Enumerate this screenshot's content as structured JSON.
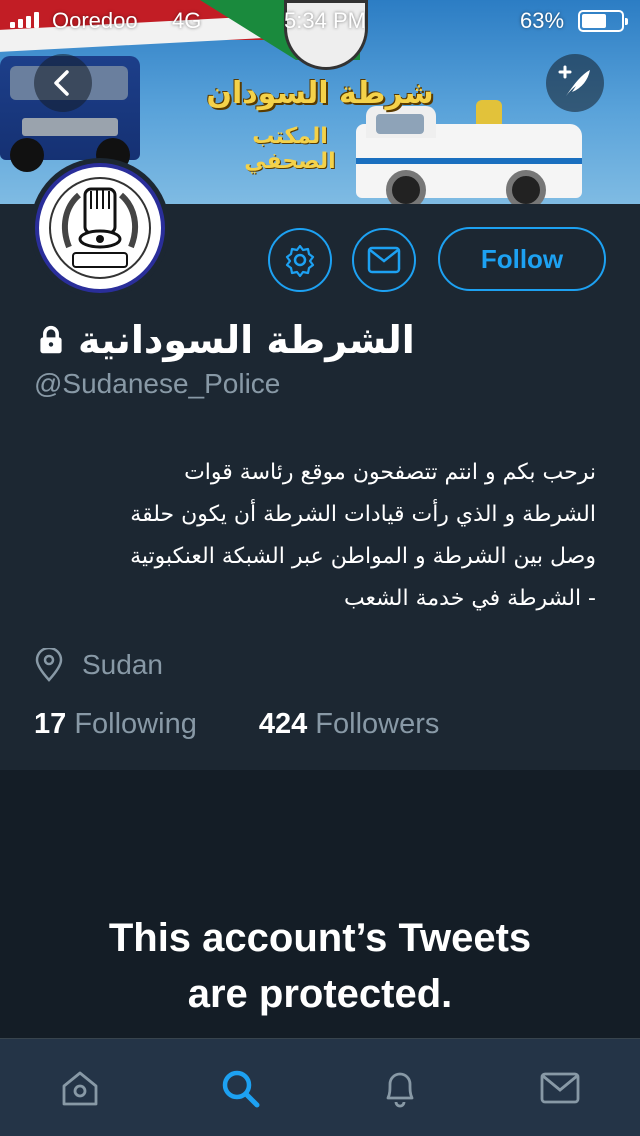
{
  "status_bar": {
    "carrier": "Ooredoo",
    "network": "4G",
    "time": "5:34 PM",
    "battery_percent": "63%",
    "battery_level": 0.63,
    "signal_bars": 4
  },
  "banner": {
    "title": "شرطة السودان",
    "subtitle": "المكتب الصحفي"
  },
  "header": {
    "back_icon": "chevron-left-icon",
    "compose_icon": "compose-tweet-icon"
  },
  "profile": {
    "display_name": "الشرطة السودانية",
    "handle": "@Sudanese_Police",
    "protected": true,
    "bio_lines": [
      "نرحب بكم و انتم تتصفحون موقع رئاسة قوات",
      "الشرطة و الذي رأت قيادات الشرطة أن يكون حلقة",
      "وصل بين الشرطة و المواطن عبر الشبكة العنكبوتية",
      "- الشرطة في خدمة الشعب"
    ],
    "location": "Sudan",
    "following_count": "17",
    "following_label": "Following",
    "followers_count": "424",
    "followers_label": "Followers"
  },
  "actions": {
    "settings_icon": "gear-icon",
    "message_icon": "envelope-icon",
    "follow_label": "Follow"
  },
  "protected_notice": {
    "line1": "This account’s Tweets",
    "line2": "are protected."
  },
  "tab_bar": {
    "tabs": [
      "home-icon",
      "search-icon",
      "notifications-icon",
      "messages-icon"
    ],
    "active": "search-icon"
  },
  "colors": {
    "accent": "#1da1f2",
    "background": "#1c2732",
    "muted_text": "#8899a6",
    "tab_bar": "#243447"
  }
}
